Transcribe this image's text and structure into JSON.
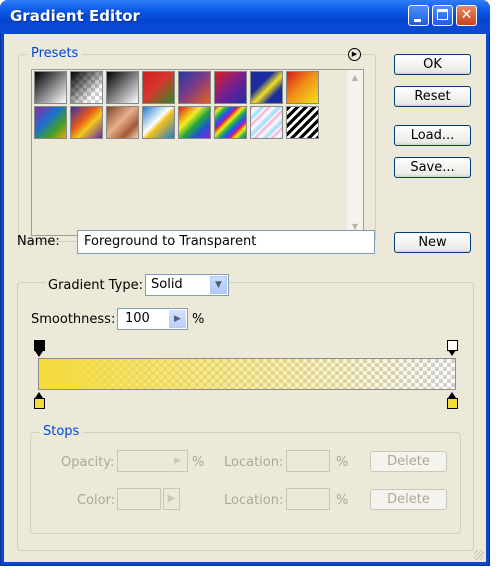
{
  "window": {
    "title": "Gradient Editor"
  },
  "presets": {
    "label": "Presets",
    "menu_icon": "circle-arrow-right-icon"
  },
  "buttons": {
    "ok": "OK",
    "reset": "Reset",
    "load": "Load...",
    "save": "Save...",
    "new": "New"
  },
  "name": {
    "label": "Name:",
    "value": "Foreground to Transparent"
  },
  "gradient_type": {
    "label": "Gradient Type:",
    "value": "Solid"
  },
  "smoothness": {
    "label": "Smoothness:",
    "value": "100",
    "unit": "%"
  },
  "gradient": {
    "start_color": "#f5db3a",
    "end_opacity": 0
  },
  "stops": {
    "label": "Stops",
    "opacity_label": "Opacity:",
    "opacity_unit": "%",
    "opacity_location_label": "Location:",
    "opacity_location_unit": "%",
    "opacity_delete": "Delete",
    "color_label": "Color:",
    "color_location_label": "Location:",
    "color_location_unit": "%",
    "color_delete": "Delete"
  }
}
